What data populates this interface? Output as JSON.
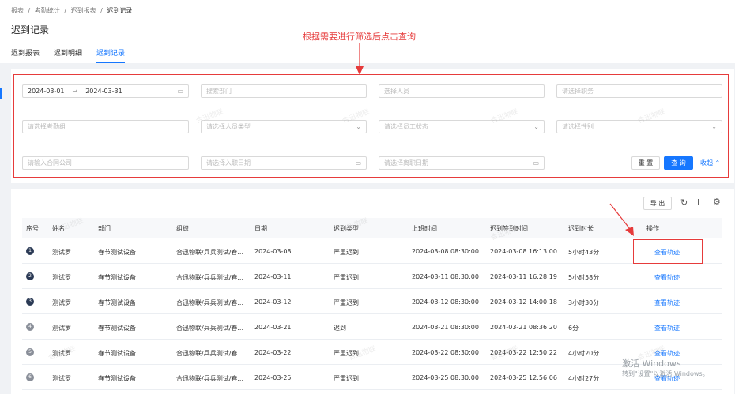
{
  "breadcrumb": [
    "报表",
    "考勤统计",
    "迟到报表",
    "迟到记录"
  ],
  "breadcrumb_sep": "/",
  "page_title": "迟到记录",
  "tabs": [
    {
      "label": "迟到报表",
      "active": false
    },
    {
      "label": "迟到明细",
      "active": false
    },
    {
      "label": "迟到记录",
      "active": true
    }
  ],
  "annotation": "根据需要进行筛选后点击查询",
  "filters": {
    "date_start": "2024-03-01",
    "date_end": "2024-03-31",
    "date_arrow": "→",
    "dept_placeholder": "搜索部门",
    "person_placeholder": "选择人员",
    "position_placeholder": "请选择职务",
    "group_placeholder": "请选择考勤组",
    "person_type_placeholder": "请选择人员类型",
    "employee_status_placeholder": "请选择员工状态",
    "gender_placeholder": "请选择性别",
    "company_placeholder": "请输入合同公司",
    "hire_date_placeholder": "请选择入职日期",
    "leave_date_placeholder": "请选择离职日期",
    "reset_label": "重 置",
    "query_label": "查 询",
    "collapse_label": "收起"
  },
  "toolbar": {
    "export_label": "导 出",
    "refresh_icon": "↻",
    "density_icon": "Ⅰ",
    "settings_icon": "⚙"
  },
  "table": {
    "columns": [
      "序号",
      "姓名",
      "部门",
      "组织",
      "日期",
      "迟到类型",
      "上班时间",
      "迟到签到时间",
      "迟到时长",
      "操作"
    ],
    "rows": [
      {
        "no": "1",
        "name": "测试罗",
        "dept": "春节测试设备",
        "org": "合迅物联/兵兵测试/春...",
        "date": "2024-03-08",
        "type": "严重迟到",
        "work_time": "2024-03-08 08:30:00",
        "sign_time": "2024-03-08 16:13:00",
        "duration": "5小时43分",
        "op": "查看轨迹"
      },
      {
        "no": "2",
        "name": "测试罗",
        "dept": "春节测试设备",
        "org": "合迅物联/兵兵测试/春...",
        "date": "2024-03-11",
        "type": "严重迟到",
        "work_time": "2024-03-11 08:30:00",
        "sign_time": "2024-03-11 16:28:19",
        "duration": "5小时58分",
        "op": "查看轨迹"
      },
      {
        "no": "3",
        "name": "测试罗",
        "dept": "春节测试设备",
        "org": "合迅物联/兵兵测试/春...",
        "date": "2024-03-12",
        "type": "严重迟到",
        "work_time": "2024-03-12 08:30:00",
        "sign_time": "2024-03-12 14:00:18",
        "duration": "3小时30分",
        "op": "查看轨迹"
      },
      {
        "no": "4",
        "name": "测试罗",
        "dept": "春节测试设备",
        "org": "合迅物联/兵兵测试/春...",
        "date": "2024-03-21",
        "type": "迟到",
        "work_time": "2024-03-21 08:30:00",
        "sign_time": "2024-03-21 08:36:20",
        "duration": "6分",
        "op": "查看轨迹"
      },
      {
        "no": "5",
        "name": "测试罗",
        "dept": "春节测试设备",
        "org": "合迅物联/兵兵测试/春...",
        "date": "2024-03-22",
        "type": "严重迟到",
        "work_time": "2024-03-22 08:30:00",
        "sign_time": "2024-03-22 12:50:22",
        "duration": "4小时20分",
        "op": "查看轨迹"
      },
      {
        "no": "6",
        "name": "测试罗",
        "dept": "春节测试设备",
        "org": "合迅物联/兵兵测试/春...",
        "date": "2024-03-25",
        "type": "严重迟到",
        "work_time": "2024-03-25 08:30:00",
        "sign_time": "2024-03-25 12:56:06",
        "duration": "4小时27分",
        "op": "查看轨迹"
      }
    ]
  },
  "watermark": "合迅物联",
  "windows_notice": {
    "line1": "激活 Windows",
    "line2": "转到\"设置\"以激活 Windows。"
  },
  "colors": {
    "accent": "#1677ff",
    "annotation": "#e63b3b"
  }
}
